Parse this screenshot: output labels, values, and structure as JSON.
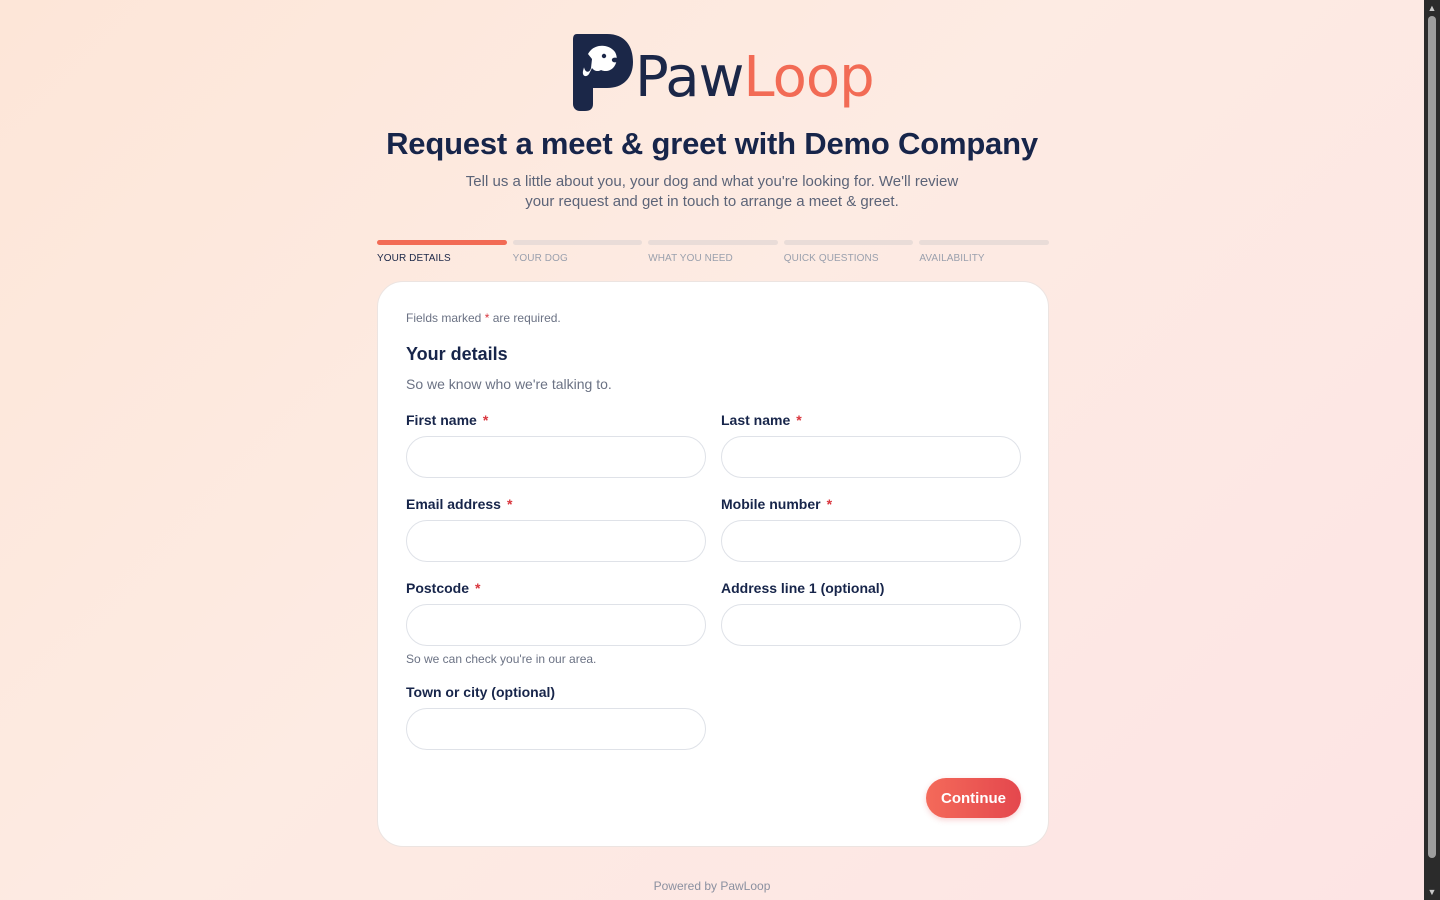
{
  "brand": {
    "name_part1": "Paw",
    "name_part2": "Loop",
    "colors": {
      "navy": "#1b2748",
      "coral": "#f26b55"
    },
    "logo_icon": "dog-head-icon"
  },
  "header": {
    "title": "Request a meet & greet with Demo Company",
    "subtitle": "Tell us a little about you, your dog and what you're looking for. We'll review your request and get in touch to arrange a meet & greet."
  },
  "steps": [
    {
      "label": "YOUR DETAILS",
      "active": true
    },
    {
      "label": "YOUR DOG",
      "active": false
    },
    {
      "label": "WHAT YOU NEED",
      "active": false
    },
    {
      "label": "QUICK QUESTIONS",
      "active": false
    },
    {
      "label": "AVAILABILITY",
      "active": false
    }
  ],
  "form": {
    "required_note_before": "Fields marked",
    "required_star": "*",
    "required_note_after": "are required.",
    "section_title": "Your details",
    "section_subtitle": "So we know who we're talking to.",
    "fields": {
      "first_name": {
        "label": "First name",
        "required": true,
        "value": "",
        "placeholder": ""
      },
      "last_name": {
        "label": "Last name",
        "required": true,
        "value": "",
        "placeholder": ""
      },
      "email": {
        "label": "Email address",
        "required": true,
        "value": "",
        "placeholder": ""
      },
      "mobile": {
        "label": "Mobile number",
        "required": true,
        "value": "",
        "placeholder": ""
      },
      "postcode": {
        "label": "Postcode",
        "required": true,
        "value": "",
        "placeholder": "",
        "hint": "So we can check you're in our area."
      },
      "address1": {
        "label": "Address line 1 (optional)",
        "required": false,
        "value": "",
        "placeholder": ""
      },
      "town": {
        "label": "Town or city (optional)",
        "required": false,
        "value": "",
        "placeholder": ""
      }
    },
    "continue_label": "Continue",
    "star": "*"
  },
  "footer": {
    "text": "Powered by PawLoop"
  },
  "scrollbar": {
    "up_icon": "scroll-up-arrow-icon",
    "down_icon": "scroll-down-arrow-icon"
  }
}
